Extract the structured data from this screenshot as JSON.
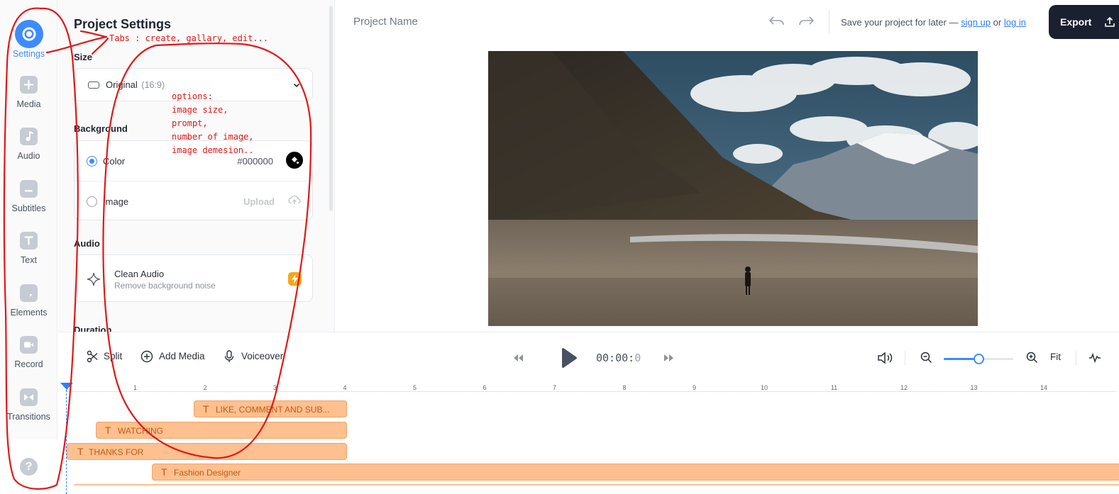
{
  "rail": {
    "items": [
      {
        "label": "Settings",
        "icon": "settings-icon"
      },
      {
        "label": "Media",
        "icon": "plus-icon"
      },
      {
        "label": "Audio",
        "icon": "music-note-icon"
      },
      {
        "label": "Subtitles",
        "icon": "subtitles-icon"
      },
      {
        "label": "Text",
        "icon": "text-icon"
      },
      {
        "label": "Elements",
        "icon": "elements-icon"
      },
      {
        "label": "Record",
        "icon": "camera-icon"
      },
      {
        "label": "Transitions",
        "icon": "transitions-icon"
      }
    ],
    "help": "?"
  },
  "panel": {
    "title": "Project Settings",
    "size": {
      "label": "Size",
      "value": "Original",
      "ratio": "(16:9)"
    },
    "background": {
      "label": "Background",
      "color_option": "Color",
      "color_value": "#000000",
      "image_option": "Image",
      "upload_label": "Upload",
      "selected": "Color"
    },
    "audio": {
      "label": "Audio",
      "name": "Clean Audio",
      "description": "Remove background noise"
    },
    "duration": {
      "label": "Duration"
    }
  },
  "header": {
    "project_name": "Project Name",
    "save_note_prefix": "Save your project for later —",
    "sign_up": "sign up",
    "or": "or",
    "log_in": "log in",
    "export": "Export"
  },
  "toolbar": {
    "split": "Split",
    "add_media": "Add Media",
    "voiceover": "Voiceover",
    "time_main": "00:00:",
    "time_frac": "0",
    "zoom_level": 0.5,
    "fit": "Fit"
  },
  "timeline": {
    "ticks": [
      "1",
      "2",
      "3",
      "4",
      "5",
      "6",
      "7",
      "8",
      "9",
      "10",
      "11",
      "12",
      "13",
      "14"
    ],
    "clips": [
      {
        "label": "LIKE, COMMENT AND SUB..."
      },
      {
        "label": "WATCHING"
      },
      {
        "label": "THANKS FOR"
      },
      {
        "label": "Fashion Designer"
      }
    ]
  },
  "annotations": {
    "tabs_note": "Tabs : create, gallary, edit...",
    "options_note": [
      "options:",
      "image size,",
      "prompt,",
      "number of image,",
      "image demesion.."
    ]
  },
  "colors": {
    "accent": "#3d8bfd",
    "export_bg": "#1b2030",
    "clip_fill": "#fdc08e",
    "clip_text": "#c25a1a",
    "annotation": "#e01818",
    "pro_badge": "#f7a51a"
  }
}
